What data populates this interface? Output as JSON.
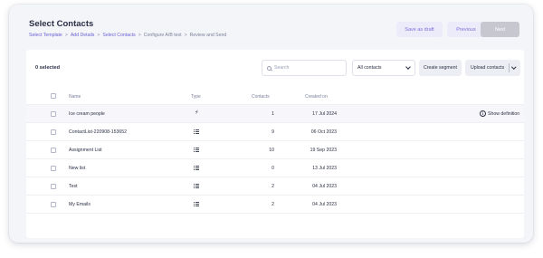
{
  "header": {
    "title": "Select Contacts",
    "breadcrumbs": [
      {
        "label": "Select Template",
        "link": true
      },
      {
        "label": "Add Details",
        "link": true
      },
      {
        "label": "Select Contacts",
        "link": true
      },
      {
        "label": "Configure A/B test",
        "link": false
      },
      {
        "label": "Review and Send",
        "link": false
      }
    ],
    "separator": ">",
    "save_draft_label": "Save as draft",
    "previous_label": "Previous",
    "next_label": "Next"
  },
  "toolbar": {
    "selected_text": "0 selected",
    "search_placeholder": "Search",
    "filter_value": "All contacts",
    "create_segment_label": "Create segment",
    "upload_contacts_label": "Upload contacts"
  },
  "table": {
    "columns": [
      "Name",
      "Type",
      "Contacts",
      "Created on"
    ],
    "rows": [
      {
        "name": "Ice cream people",
        "type_icon": "bolt-icon",
        "contacts": "1",
        "created": "17 Jul 2024",
        "action": "Show definition"
      },
      {
        "name": "ContactList-220908-153652",
        "type_icon": "list-icon",
        "contacts": "9",
        "created": "06 Oct 2023",
        "action": ""
      },
      {
        "name": "Assignment List",
        "type_icon": "list-icon",
        "contacts": "10",
        "created": "19 Sep 2023",
        "action": ""
      },
      {
        "name": "New list",
        "type_icon": "list-icon",
        "contacts": "0",
        "created": "13 Jul 2023",
        "action": ""
      },
      {
        "name": "Test",
        "type_icon": "list-icon",
        "contacts": "2",
        "created": "04 Jul 2023",
        "action": ""
      },
      {
        "name": "My Emails",
        "type_icon": "list-icon",
        "contacts": "2",
        "created": "04 Jul 2023",
        "action": ""
      }
    ]
  },
  "colors": {
    "accent": "#6a5fd3",
    "accent_bg": "#ecebfa",
    "disabled": "#c6c7cf",
    "text": "#2b2f45"
  }
}
